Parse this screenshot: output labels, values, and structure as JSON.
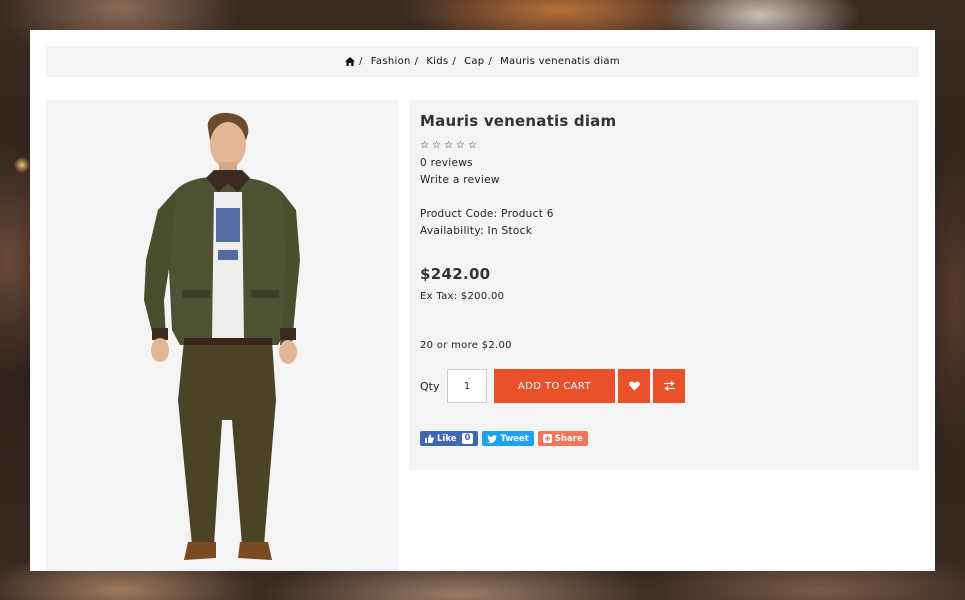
{
  "breadcrumb": {
    "items": [
      "Fashion",
      "Kids",
      "Cap",
      "Mauris venenatis diam"
    ],
    "separator": "/"
  },
  "icons": {
    "home": "home-icon",
    "star": "star-outline-icon",
    "wishlist": "heart-icon",
    "compare": "exchange-icon",
    "facebook": "facebook-like-icon",
    "twitter": "twitter-icon",
    "share": "plus-share-icon"
  },
  "product": {
    "title": "Mauris venenatis diam",
    "rating": 0,
    "stars": [
      "☆",
      "☆",
      "☆",
      "☆",
      "☆"
    ],
    "reviews": "0 reviews",
    "write_review": "Write a review",
    "product_code": "Product Code: Product 6",
    "availability": "Availability: In Stock",
    "price": "$242.00",
    "ex_tax": "Ex Tax: $200.00",
    "discount": "20 or more $2.00"
  },
  "cart": {
    "qty_label": "Qty",
    "qty_value": "1",
    "add_to_cart": "ADD TO CART"
  },
  "social": {
    "like": "Like",
    "like_count": "0",
    "tweet": "Tweet",
    "share": "Share"
  },
  "colors": {
    "accent": "#e8512a",
    "panel_bg": "#f4f4f4",
    "facebook": "#4267b2",
    "twitter": "#1da1f2",
    "share": "#f0755a"
  }
}
